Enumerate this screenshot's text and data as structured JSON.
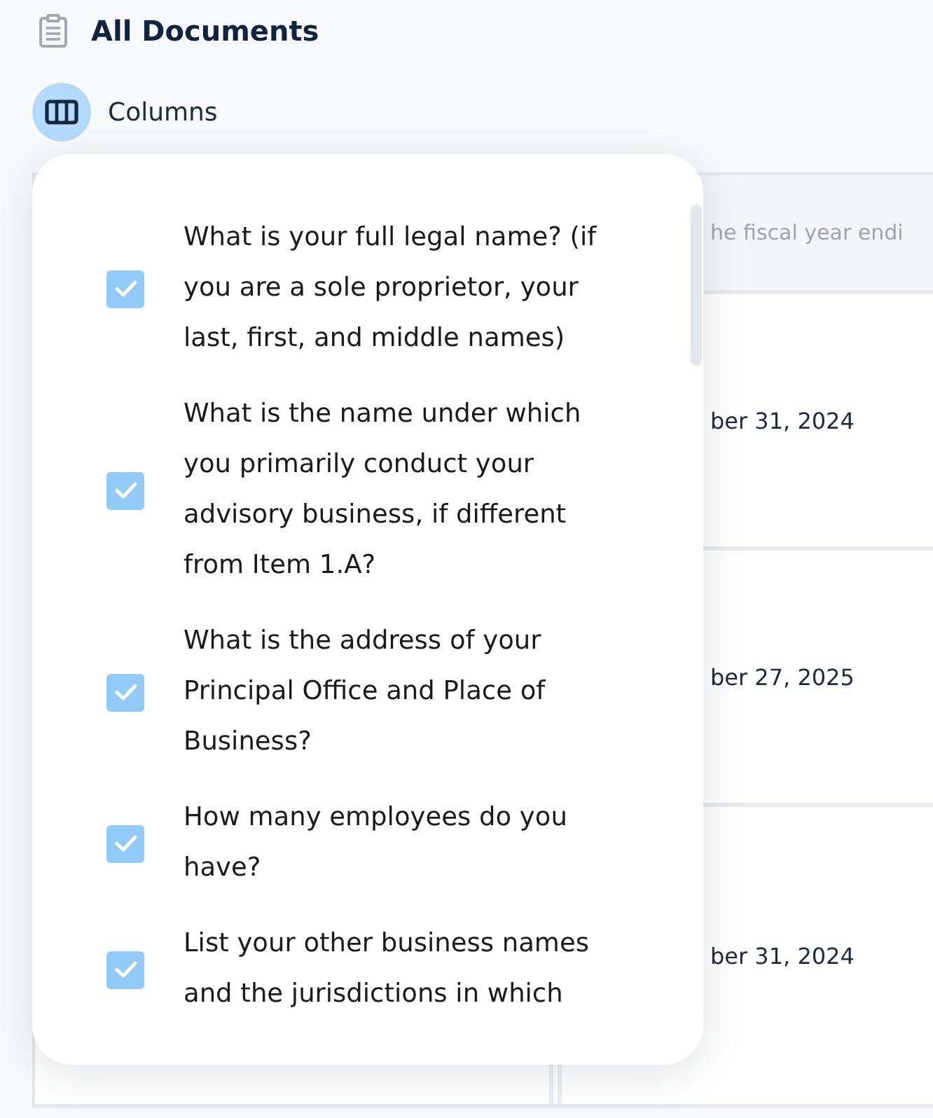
{
  "title": "All Documents",
  "columns_button": {
    "label": "Columns",
    "expanded": true
  },
  "columns_menu": {
    "items": [
      {
        "label": "What is your full legal name? (if you are a sole proprietor, your last, first, and middle names)",
        "checked": true
      },
      {
        "label": "What is the name under which you primarily conduct your advisory business, if different from Item 1.A?",
        "checked": true
      },
      {
        "label": "What is the address of your Principal Office and Place of Business?",
        "checked": true
      },
      {
        "label": "How many employees do you have?",
        "checked": true
      },
      {
        "label": "List your other business names and the jurisdictions in which",
        "checked": true
      }
    ]
  },
  "table": {
    "column_2_header": "he fiscal year endi",
    "rows": [
      {
        "column_2": "ber 31, 2024"
      },
      {
        "column_2": "ber 27, 2025"
      },
      {
        "column_2": "ber 31, 2024"
      }
    ]
  }
}
